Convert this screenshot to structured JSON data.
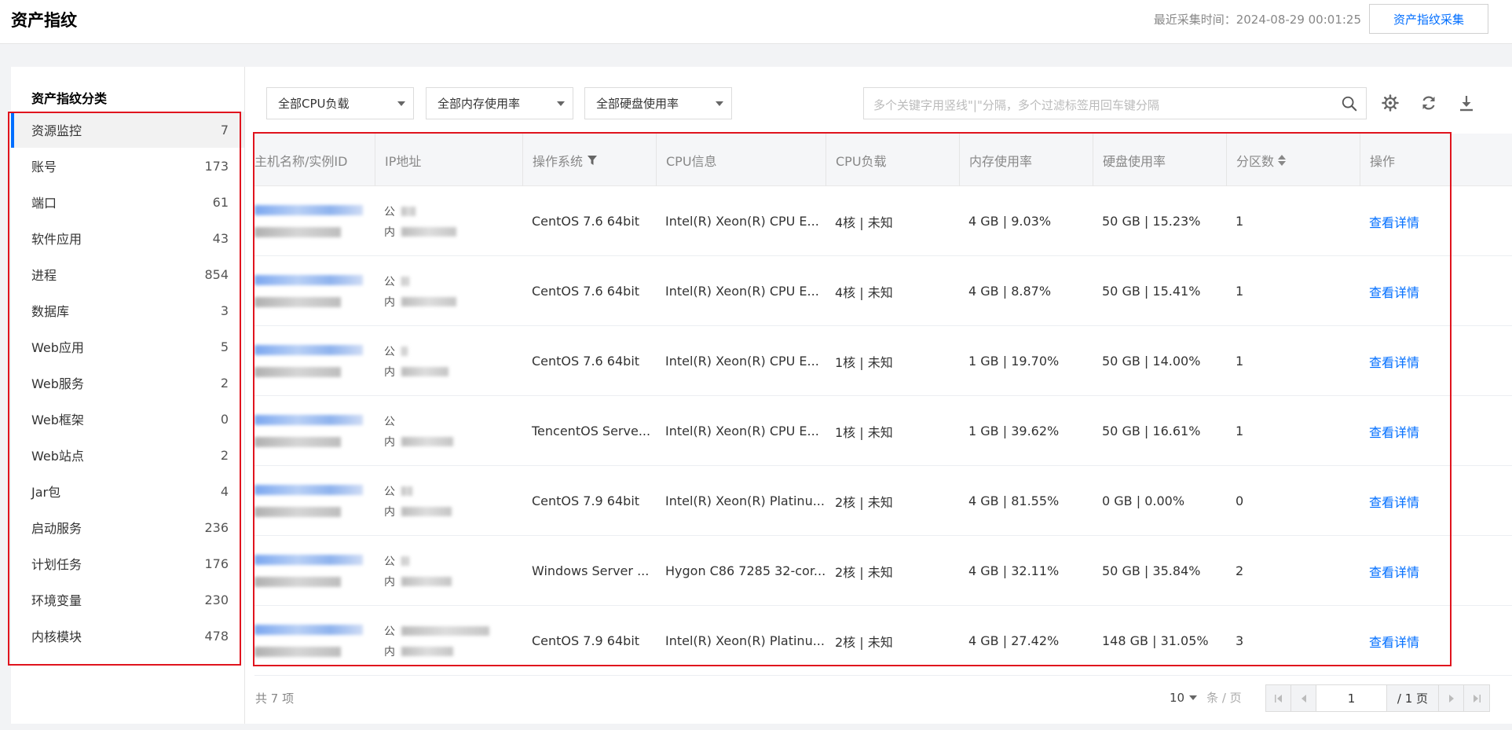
{
  "header": {
    "title": "资产指纹",
    "collect_time": "最近采集时间：2024-08-29 00:01:25",
    "collect_button": "资产指纹采集"
  },
  "sidebar": {
    "title": "资产指纹分类",
    "items": [
      {
        "label": "资源监控",
        "count": "7"
      },
      {
        "label": "账号",
        "count": "173"
      },
      {
        "label": "端口",
        "count": "61"
      },
      {
        "label": "软件应用",
        "count": "43"
      },
      {
        "label": "进程",
        "count": "854"
      },
      {
        "label": "数据库",
        "count": "3"
      },
      {
        "label": "Web应用",
        "count": "5"
      },
      {
        "label": "Web服务",
        "count": "2"
      },
      {
        "label": "Web框架",
        "count": "0"
      },
      {
        "label": "Web站点",
        "count": "2"
      },
      {
        "label": "Jar包",
        "count": "4"
      },
      {
        "label": "启动服务",
        "count": "236"
      },
      {
        "label": "计划任务",
        "count": "176"
      },
      {
        "label": "环境变量",
        "count": "230"
      },
      {
        "label": "内核模块",
        "count": "478"
      }
    ]
  },
  "filters": {
    "cpu": "全部CPU负载",
    "mem": "全部内存使用率",
    "disk": "全部硬盘使用率",
    "search_placeholder": "多个关键字用竖线\"|\"分隔，多个过滤标签用回车键分隔"
  },
  "icons": {
    "search": "search-icon",
    "settings": "gear-icon",
    "refresh": "refresh-icon",
    "download": "download-icon",
    "filter": "filter-icon",
    "sort": "sort-icon"
  },
  "table": {
    "columns": [
      "主机名称/实例ID",
      "IP地址",
      "操作系统",
      "CPU信息",
      "CPU负载",
      "内存使用率",
      "硬盘使用率",
      "分区数",
      "操作"
    ],
    "ip_labels": {
      "public": "公",
      "private": "内"
    },
    "rows": [
      {
        "os": "CentOS 7.6 64bit",
        "cpu_info": "Intel(R) Xeon(R) CPU E...",
        "cpu_load": "4核 | 未知",
        "mem": "4 GB | 9.03%",
        "disk": "50 GB | 15.23%",
        "partitions": "1",
        "action": "查看详情"
      },
      {
        "os": "CentOS 7.6 64bit",
        "cpu_info": "Intel(R) Xeon(R) CPU E...",
        "cpu_load": "4核 | 未知",
        "mem": "4 GB | 8.87%",
        "disk": "50 GB | 15.41%",
        "partitions": "1",
        "action": "查看详情"
      },
      {
        "os": "CentOS 7.6 64bit",
        "cpu_info": "Intel(R) Xeon(R) CPU E...",
        "cpu_load": "1核 | 未知",
        "mem": "1 GB | 19.70%",
        "disk": "50 GB | 14.00%",
        "partitions": "1",
        "action": "查看详情"
      },
      {
        "os": "TencentOS Serve...",
        "cpu_info": "Intel(R) Xeon(R) CPU E...",
        "cpu_load": "1核 | 未知",
        "mem": "1 GB | 39.62%",
        "disk": "50 GB | 16.61%",
        "partitions": "1",
        "action": "查看详情"
      },
      {
        "os": "CentOS 7.9 64bit",
        "cpu_info": "Intel(R) Xeon(R) Platinu...",
        "cpu_load": "2核 | 未知",
        "mem": "4 GB | 81.55%",
        "disk": "0 GB | 0.00%",
        "partitions": "0",
        "action": "查看详情"
      },
      {
        "os": "Windows Server ...",
        "cpu_info": "Hygon C86 7285 32-cor...",
        "cpu_load": "2核 | 未知",
        "mem": "4 GB | 32.11%",
        "disk": "50 GB | 35.84%",
        "partitions": "2",
        "action": "查看详情"
      },
      {
        "os": "CentOS 7.9 64bit",
        "cpu_info": "Intel(R) Xeon(R) Platinu...",
        "cpu_load": "2核 | 未知",
        "mem": "4 GB | 27.42%",
        "disk": "148 GB | 31.05%",
        "partitions": "3",
        "action": "查看详情"
      }
    ]
  },
  "footer": {
    "total": "共 7 项",
    "page_size": "10",
    "page_size_unit": "条 / 页",
    "current_page": "1",
    "total_pages": "/ 1 页"
  }
}
